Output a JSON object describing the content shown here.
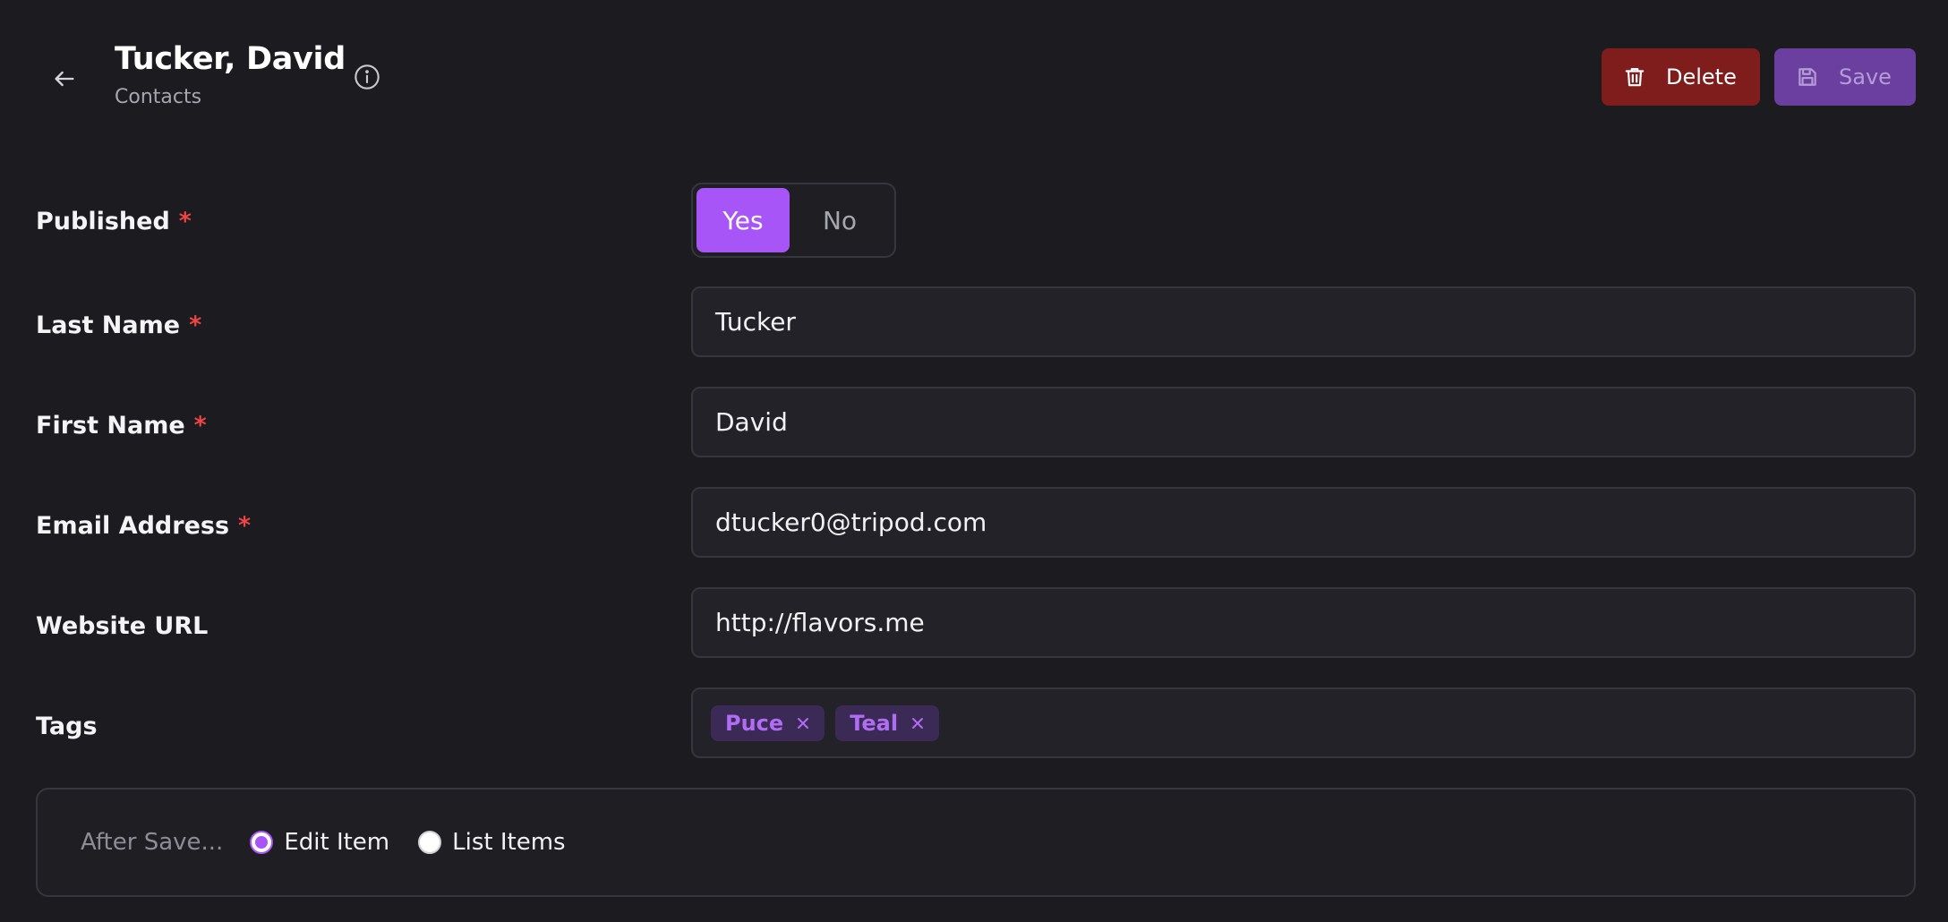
{
  "header": {
    "title": "Tucker, David",
    "subtitle": "Contacts",
    "delete_label": "Delete",
    "save_label": "Save"
  },
  "form": {
    "published": {
      "label": "Published",
      "required": "*",
      "options": [
        "Yes",
        "No"
      ],
      "selected": "Yes"
    },
    "last_name": {
      "label": "Last Name",
      "required": "*",
      "value": "Tucker"
    },
    "first_name": {
      "label": "First Name",
      "required": "*",
      "value": "David"
    },
    "email": {
      "label": "Email Address",
      "required": "*",
      "value": "dtucker0@tripod.com"
    },
    "website": {
      "label": "Website URL",
      "value": "http://flavors.me"
    },
    "tags": {
      "label": "Tags",
      "items": [
        "Puce",
        "Teal"
      ]
    }
  },
  "after_save": {
    "label": "After Save...",
    "options": [
      "Edit Item",
      "List Items"
    ],
    "selected": "Edit Item"
  },
  "colors": {
    "background": "#1b1b20",
    "accent": "#a855f7",
    "delete": "#7f1d1d",
    "save": "#6b3fa0",
    "required": "#ef4444"
  },
  "icons": {
    "back": "arrow-left-icon",
    "info": "info-icon",
    "delete": "trash-icon",
    "save": "floppy-disk-icon",
    "tag_remove": "close-icon"
  }
}
